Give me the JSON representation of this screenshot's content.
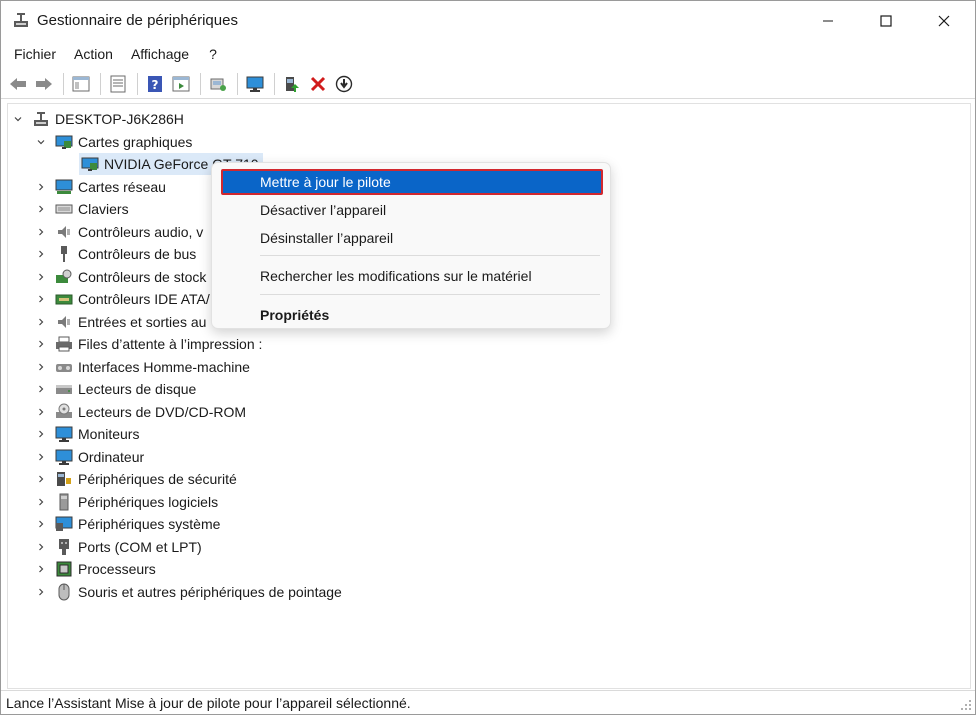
{
  "window": {
    "title": "Gestionnaire de périphériques"
  },
  "menu": [
    "Fichier",
    "Action",
    "Affichage",
    "?"
  ],
  "toolbar_icons": [
    "back-icon",
    "forward-icon",
    "properties-pane-icon",
    "list-icon",
    "help-icon",
    "view-icon",
    "scan-icon",
    "monitor-icon",
    "update-driver-icon",
    "uninstall-icon",
    "disable-icon"
  ],
  "tree": {
    "root": "DESKTOP-J6K286H",
    "categories": [
      {
        "label": "Cartes graphiques",
        "expanded": true,
        "icon": "display-adapter-icon"
      },
      {
        "label": "Cartes réseau",
        "icon": "network-icon"
      },
      {
        "label": "Claviers",
        "icon": "keyboard-icon"
      },
      {
        "label": "Contrôleurs audio, v",
        "icon": "audio-icon"
      },
      {
        "label": "Contrôleurs de bus",
        "icon": "usb-icon"
      },
      {
        "label": "Contrôleurs de stock",
        "icon": "storage-controller-icon"
      },
      {
        "label": "Contrôleurs IDE ATA/",
        "icon": "ide-icon"
      },
      {
        "label": "Entrées et sorties au",
        "icon": "audio-io-icon"
      },
      {
        "label": "Files d’attente à l’impression :",
        "icon": "printer-icon"
      },
      {
        "label": "Interfaces Homme-machine",
        "icon": "hid-icon"
      },
      {
        "label": "Lecteurs de disque",
        "icon": "disk-icon"
      },
      {
        "label": "Lecteurs de DVD/CD-ROM",
        "icon": "dvd-icon"
      },
      {
        "label": "Moniteurs",
        "icon": "monitor-icon"
      },
      {
        "label": "Ordinateur",
        "icon": "computer-icon"
      },
      {
        "label": "Périphériques de sécurité",
        "icon": "security-icon"
      },
      {
        "label": "Périphériques logiciels",
        "icon": "software-device-icon"
      },
      {
        "label": "Périphériques système",
        "icon": "system-device-icon"
      },
      {
        "label": "Ports (COM et LPT)",
        "icon": "port-icon"
      },
      {
        "label": "Processeurs",
        "icon": "processor-icon"
      },
      {
        "label": "Souris et autres périphériques de pointage",
        "icon": "mouse-icon"
      }
    ],
    "selected_device": "NVIDIA GeForce GT 710"
  },
  "context_menu": {
    "items": [
      "Mettre à jour le pilote",
      "Désactiver l’appareil",
      "Désinstaller l’appareil",
      "Rechercher les modifications sur le matériel",
      "Propriétés"
    ],
    "highlighted": "Mettre à jour le pilote"
  },
  "status": "Lance l’Assistant Mise à jour de pilote pour l’appareil sélectionné.",
  "colors": {
    "highlight": "#0a65c8",
    "outline": "#d1282f",
    "selection": "#dbe9f8"
  }
}
